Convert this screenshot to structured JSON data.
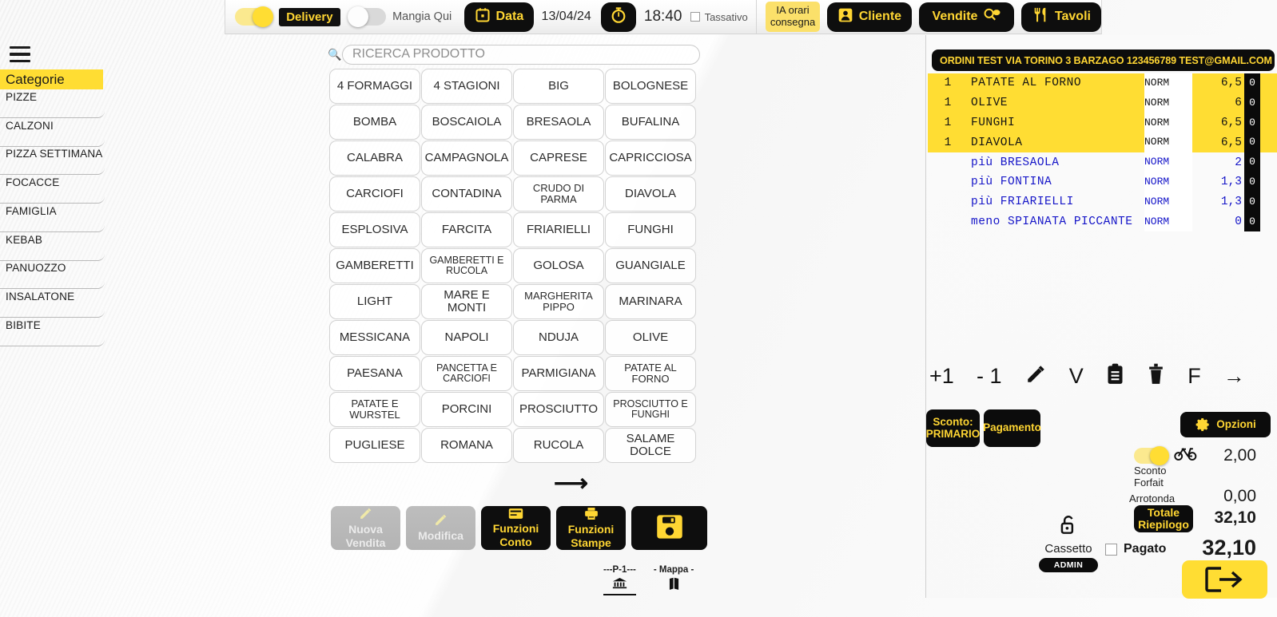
{
  "topbar": {
    "delivery_toggle": {
      "label": "Delivery",
      "state": "on"
    },
    "mangia_qui_toggle": {
      "label": "Mangia Qui",
      "state": "off"
    },
    "data_button": {
      "label": "Data",
      "icon": "calendar-icon"
    },
    "date_value": "13/04/24",
    "time_button": {
      "icon": "timer-icon"
    },
    "time_value": "18:40",
    "tassativo": {
      "label": "Tassativo",
      "checked": false
    },
    "ia_button": {
      "line1": "IA orari",
      "line2": "consegna"
    },
    "cliente_button": {
      "label": "Cliente",
      "icon": "person-icon"
    },
    "vendite_button": {
      "label": "Vendite",
      "icon": "search-icon"
    },
    "tavoli_button": {
      "label": "Tavoli",
      "icon": "cutlery-icon"
    }
  },
  "sidebar": {
    "header": "Categorie",
    "items": [
      {
        "label": "PIZZE"
      },
      {
        "label": "CALZONI"
      },
      {
        "label": "PIZZA SETTIMANA"
      },
      {
        "label": "FOCACCE"
      },
      {
        "label": "FAMIGLIA"
      },
      {
        "label": "KEBAB"
      },
      {
        "label": "PANUOZZO"
      },
      {
        "label": "INSALATONE"
      },
      {
        "label": "BIBITE"
      }
    ]
  },
  "search": {
    "placeholder": "RICERCA PRODOTTO",
    "value": ""
  },
  "products": [
    {
      "label": "4 FORMAGGI"
    },
    {
      "label": "4 STAGIONI"
    },
    {
      "label": "BIG"
    },
    {
      "label": "BOLOGNESE"
    },
    {
      "label": "BOMBA"
    },
    {
      "label": "BOSCAIOLA"
    },
    {
      "label": "BRESAOLA"
    },
    {
      "label": "BUFALINA"
    },
    {
      "label": "CALABRA"
    },
    {
      "label": "CAMPAGNOLA"
    },
    {
      "label": "CAPRESE"
    },
    {
      "label": "CAPRICCIOSA"
    },
    {
      "label": "CARCIOFI"
    },
    {
      "label": "CONTADINA"
    },
    {
      "label": "CRUDO DI PARMA"
    },
    {
      "label": "DIAVOLA"
    },
    {
      "label": "ESPLOSIVA"
    },
    {
      "label": "FARCITA"
    },
    {
      "label": "FRIARIELLI"
    },
    {
      "label": "FUNGHI"
    },
    {
      "label": "GAMBERETTI"
    },
    {
      "label": "GAMBERETTI E RUCOLA"
    },
    {
      "label": "GOLOSA"
    },
    {
      "label": "GUANGIALE"
    },
    {
      "label": "LIGHT"
    },
    {
      "label": "MARE E MONTI"
    },
    {
      "label": "MARGHERITA PIPPO"
    },
    {
      "label": "MARINARA"
    },
    {
      "label": "MESSICANA"
    },
    {
      "label": "NAPOLI"
    },
    {
      "label": "NDUJA"
    },
    {
      "label": "OLIVE"
    },
    {
      "label": "PAESANA"
    },
    {
      "label": "PANCETTA E CARCIOFI"
    },
    {
      "label": "PARMIGIANA"
    },
    {
      "label": "PATATE AL FORNO"
    },
    {
      "label": "PATATE E WURSTEL"
    },
    {
      "label": "PORCINI"
    },
    {
      "label": "PROSCIUTTO"
    },
    {
      "label": "PROSCIUTTO E FUNGHI"
    },
    {
      "label": "PUGLIESE"
    },
    {
      "label": "ROMANA"
    },
    {
      "label": "RUCOLA"
    },
    {
      "label": "SALAME DOLCE"
    }
  ],
  "grid_next_icon": "arrow-right-icon",
  "bottom_toolbar": [
    {
      "line1": "Nuova",
      "line2": "Vendita",
      "icon": "pencil-icon",
      "state": "disabled"
    },
    {
      "line1": "Modifica",
      "line2": "",
      "icon": "pencil-icon",
      "state": "disabled"
    },
    {
      "line1": "Funzioni",
      "line2": "Conto",
      "icon": "card-icon",
      "state": "active"
    },
    {
      "line1": "Funzioni",
      "line2": "Stampe",
      "icon": "printer-icon",
      "state": "active"
    },
    {
      "line1": "",
      "line2": "",
      "icon": "save-icon",
      "state": "active"
    }
  ],
  "footer_marks": [
    {
      "label": "---P-1---",
      "icon": "bank-icon"
    },
    {
      "label": "- Mappa -",
      "icon": "map-icon"
    }
  ],
  "order": {
    "header": "ORDINI TEST VIA TORINO 3 BARZAGO 123456789 TEST@GMAIL.COM",
    "lines": [
      {
        "type": "main",
        "qty": "1",
        "name": "PATATE AL FORNO",
        "mode": "NORM",
        "price": "6,5",
        "scroll": "0"
      },
      {
        "type": "main",
        "qty": "1",
        "name": "OLIVE",
        "mode": "NORM",
        "price": "6",
        "scroll": "0"
      },
      {
        "type": "main",
        "qty": "1",
        "name": "FUNGHI",
        "mode": "NORM",
        "price": "6,5",
        "scroll": "0"
      },
      {
        "type": "main",
        "qty": "1",
        "name": "DIAVOLA",
        "mode": "NORM",
        "price": "6,5",
        "scroll": "0"
      },
      {
        "type": "var",
        "qty": "",
        "name": "più BRESAOLA",
        "mode": "NORM",
        "price": "2",
        "scroll": "0"
      },
      {
        "type": "var",
        "qty": "",
        "name": "più FONTINA",
        "mode": "NORM",
        "price": "1,3",
        "scroll": "0"
      },
      {
        "type": "var",
        "qty": "",
        "name": "più FRIARIELLI",
        "mode": "NORM",
        "price": "1,3",
        "scroll": "0"
      },
      {
        "type": "var",
        "qty": "",
        "name": "meno SPIANATA PICCANTE",
        "mode": "NORM",
        "price": "0",
        "scroll": "0"
      }
    ]
  },
  "actions": [
    {
      "label": "+1",
      "name": "increment"
    },
    {
      "label": "- 1",
      "name": "decrement"
    },
    {
      "label": "",
      "name": "edit",
      "icon": "pencil-icon"
    },
    {
      "label": "V",
      "name": "variant"
    },
    {
      "label": "",
      "name": "notes",
      "icon": "clipboard-icon"
    },
    {
      "label": "",
      "name": "delete",
      "icon": "trash-icon"
    },
    {
      "label": "F",
      "name": "function"
    },
    {
      "label": "→",
      "name": "forward"
    }
  ],
  "right_controls": {
    "sconto_button": {
      "line1": "Sconto:",
      "line2": "PRIMARIO"
    },
    "pagamento_button": {
      "label": "Pagamento"
    },
    "opzioni_button": {
      "label": "Opzioni",
      "icon": "gear-icon"
    },
    "totale_riepilogo_button": {
      "line1": "Totale",
      "line2": "Riepilogo"
    },
    "delivery_fee_toggle": {
      "state": "on",
      "icon": "bicycle-icon"
    },
    "delivery_fee_amount": "2,00",
    "sconto_forfait_label": "Sconto\nForfait",
    "arrotonda_label": "Arrotonda",
    "arrotonda_amount": "0,00",
    "totale_amount": "32,10",
    "pagato_amount": "32,10",
    "pagato_checkbox": {
      "label": "Pagato",
      "checked": false
    },
    "cassetto": {
      "label": "Cassetto",
      "badge": "ADMIN",
      "icon": "unlock-icon"
    },
    "exit_button": {
      "icon": "exit-icon"
    }
  },
  "colors": {
    "accent_yellow": "#ffdd33",
    "pale_yellow": "#fbe06a",
    "black": "#0c0c0c",
    "variant_blue": "#1515c8"
  }
}
